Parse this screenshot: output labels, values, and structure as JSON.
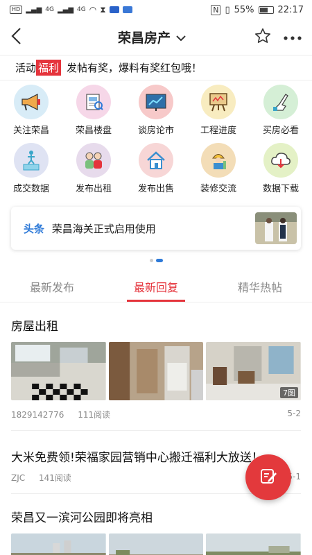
{
  "status_bar": {
    "left": "HD",
    "signal1": "4G",
    "signal2": "4G",
    "battery": "55%",
    "time": "22:17"
  },
  "header": {
    "title": "荣昌房产"
  },
  "banner": {
    "activity": "活动",
    "welfare": "福利",
    "text": "发帖有奖，爆料有奖红包哦！"
  },
  "grid": [
    {
      "label": "关注荣昌",
      "icon": "megaphone-icon",
      "bg": "#d8ecf7"
    },
    {
      "label": "荣昌楼盘",
      "icon": "building-doc-icon",
      "bg": "#f6d7e8"
    },
    {
      "label": "谈房论市",
      "icon": "chart-board-icon",
      "bg": "#f7c9c9"
    },
    {
      "label": "工程进度",
      "icon": "easel-icon",
      "bg": "#f8ecc0"
    },
    {
      "label": "买房必看",
      "icon": "pointing-hand-icon",
      "bg": "#d5efd6"
    },
    {
      "label": "成交数据",
      "icon": "podium-icon",
      "bg": "#dfe3f3"
    },
    {
      "label": "发布出租",
      "icon": "people-icon",
      "bg": "#e7dbec"
    },
    {
      "label": "发布出售",
      "icon": "house-icon",
      "bg": "#f7d6d6"
    },
    {
      "label": "装修交流",
      "icon": "worker-icon",
      "bg": "#f3ddb7"
    },
    {
      "label": "数据下载",
      "icon": "cloud-download-icon",
      "bg": "#e4f1c6"
    }
  ],
  "headline": {
    "tag": "头条",
    "text": "荣昌海关正式启用使用"
  },
  "tabs": [
    {
      "label": "最新发布"
    },
    {
      "label": "最新回复"
    },
    {
      "label": "精华热帖"
    }
  ],
  "posts": [
    {
      "title": "房屋出租",
      "author": "1829142776",
      "reads": "111阅读",
      "date": "5-2",
      "photo_count": "7图"
    },
    {
      "title": "大米免费领!荣福家园营销中心搬迁福利大放送！",
      "author": "ZJC",
      "reads": "141阅读",
      "date": "5-1"
    },
    {
      "title": "荣昌又一滨河公园即将亮相"
    }
  ],
  "colors": {
    "accent": "#e5343c",
    "link_blue": "#2e7ad8"
  }
}
